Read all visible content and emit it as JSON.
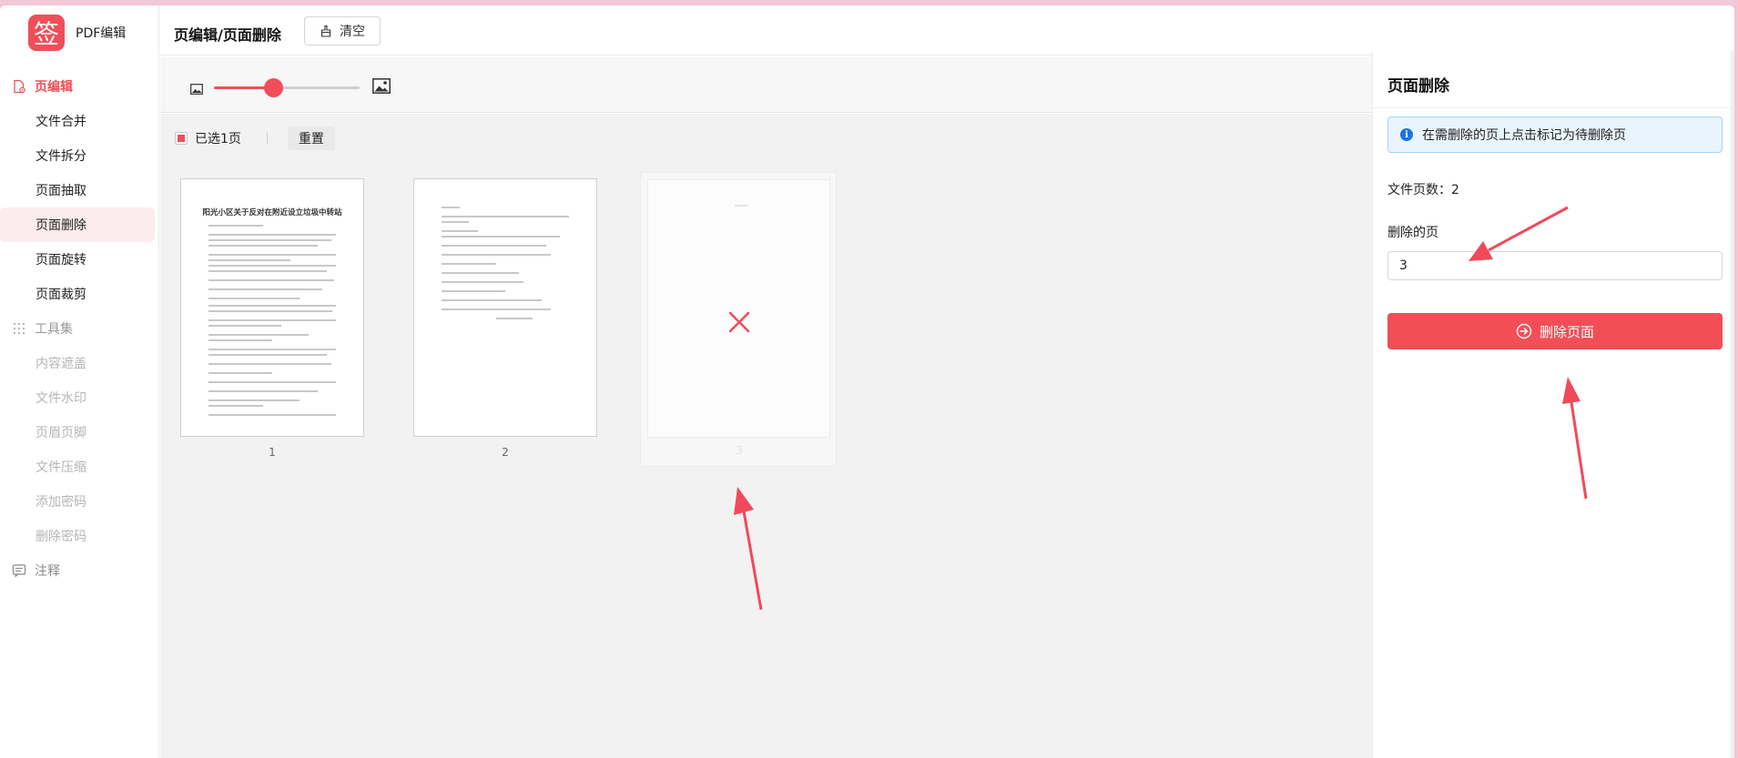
{
  "app": {
    "logo_char": "签",
    "logo_text": "PDF编辑"
  },
  "sidebar": {
    "section_page_edit": "页编辑",
    "items_page_edit": [
      {
        "label": "文件合并"
      },
      {
        "label": "文件拆分"
      },
      {
        "label": "页面抽取"
      },
      {
        "label": "页面删除"
      },
      {
        "label": "页面旋转"
      },
      {
        "label": "页面裁剪"
      }
    ],
    "section_tools": "工具集",
    "items_tools": [
      {
        "label": "内容遮盖"
      },
      {
        "label": "文件水印"
      },
      {
        "label": "页眉页脚"
      },
      {
        "label": "文件压缩"
      },
      {
        "label": "添加密码"
      },
      {
        "label": "删除密码"
      }
    ],
    "section_annot": "注释"
  },
  "header": {
    "title": "页编辑/页面删除",
    "clear_label": "清空"
  },
  "zoom": {
    "value_fraction": 0.41
  },
  "selection": {
    "selected_text": "已选1页",
    "reset_label": "重置"
  },
  "pages": [
    {
      "number": "1",
      "doc_title": "阳光小区关于反对在附近设立垃圾中转站"
    },
    {
      "number": "2"
    },
    {
      "number": "3",
      "marked_for_delete": true
    }
  ],
  "right_panel": {
    "title": "页面删除",
    "info": "在需删除的页上点击标记为待删除页",
    "page_count_label": "文件页数：",
    "page_count_value": "2",
    "delete_pages_label": "删除的页",
    "delete_pages_value": "3",
    "delete_button": "删除页面"
  },
  "colors": {
    "accent": "#f04e58",
    "info_blue": "#1a73e8",
    "annotation_arrow": "#f2495a"
  }
}
